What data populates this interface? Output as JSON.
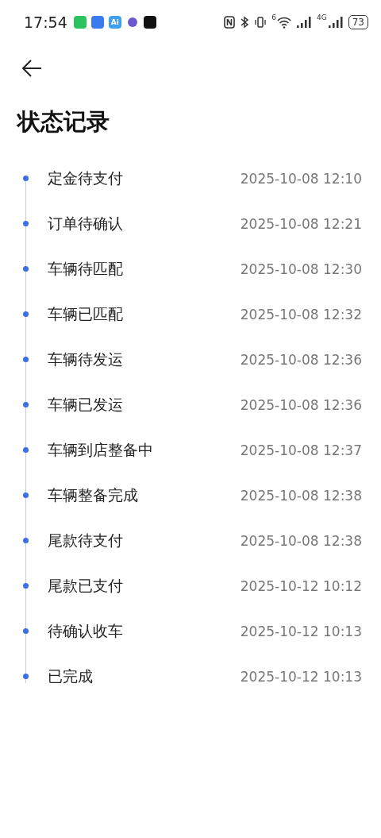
{
  "status_bar": {
    "time": "17:54",
    "app_icon_text": "Ai",
    "wifi_badge": "6",
    "network": "4G",
    "battery": "73"
  },
  "title": "状态记录",
  "timeline": [
    {
      "status": "定金待支付",
      "time": "2025-10-08 12:10"
    },
    {
      "status": "订单待确认",
      "time": "2025-10-08 12:21"
    },
    {
      "status": "车辆待匹配",
      "time": "2025-10-08 12:30"
    },
    {
      "status": "车辆已匹配",
      "time": "2025-10-08 12:32"
    },
    {
      "status": "车辆待发运",
      "time": "2025-10-08 12:36"
    },
    {
      "status": "车辆已发运",
      "time": "2025-10-08 12:36"
    },
    {
      "status": "车辆到店整备中",
      "time": "2025-10-08 12:37"
    },
    {
      "status": "车辆整备完成",
      "time": "2025-10-08 12:38"
    },
    {
      "status": "尾款待支付",
      "time": "2025-10-08 12:38"
    },
    {
      "status": "尾款已支付",
      "time": "2025-10-12 10:12"
    },
    {
      "status": "待确认收车",
      "time": "2025-10-12 10:13"
    },
    {
      "status": "已完成",
      "time": "2025-10-12 10:13"
    }
  ]
}
